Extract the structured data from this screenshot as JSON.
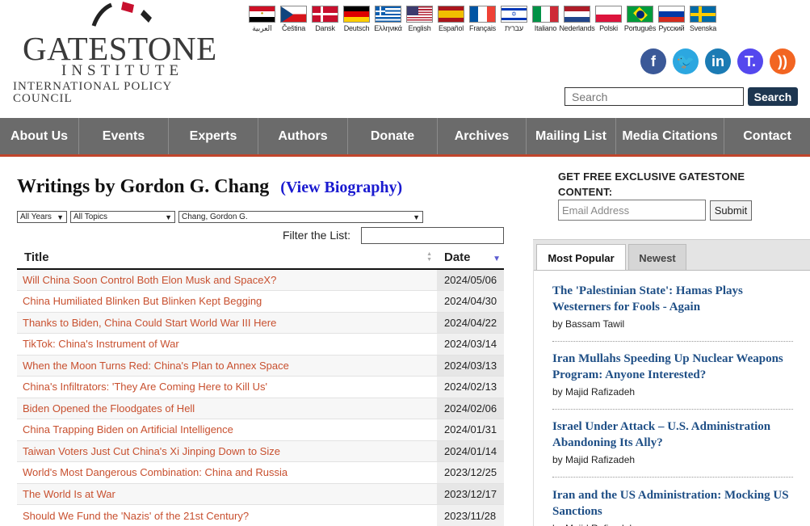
{
  "header": {
    "logo_main": "GATESTONE",
    "logo_sub": "INSTITUTE",
    "logo_tag": "INTERNATIONAL POLICY COUNCIL",
    "languages": [
      {
        "label": "العربية",
        "flag": "eg"
      },
      {
        "label": "Čeština",
        "flag": "cz"
      },
      {
        "label": "Dansk",
        "flag": "dk"
      },
      {
        "label": "Deutsch",
        "flag": "de"
      },
      {
        "label": "Ελληνικά",
        "flag": "gr"
      },
      {
        "label": "English",
        "flag": "us"
      },
      {
        "label": "Español",
        "flag": "es"
      },
      {
        "label": "Français",
        "flag": "fr"
      },
      {
        "label": "עברית",
        "flag": "il"
      },
      {
        "label": "Italiano",
        "flag": "it"
      },
      {
        "label": "Nederlands",
        "flag": "nl"
      },
      {
        "label": "Polski",
        "flag": "pl"
      },
      {
        "label": "Português",
        "flag": "br"
      },
      {
        "label": "Русский",
        "flag": "ru"
      },
      {
        "label": "Svenska",
        "flag": "se"
      }
    ],
    "social": [
      {
        "name": "facebook-icon",
        "glyph": "f",
        "color": "#3b5998"
      },
      {
        "name": "twitter-icon",
        "glyph": "🐦",
        "color": "#2ca7e0"
      },
      {
        "name": "linkedin-icon",
        "glyph": "in",
        "color": "#1b7bb4"
      },
      {
        "name": "truth-social-icon",
        "glyph": "T.",
        "color": "#5448ee"
      },
      {
        "name": "rss-icon",
        "glyph": "))",
        "color": "#f26522"
      }
    ],
    "search_placeholder": "Search",
    "search_button": "Search"
  },
  "nav": [
    {
      "label": "About Us",
      "w": 98
    },
    {
      "label": "Events",
      "w": 111
    },
    {
      "label": "Experts",
      "w": 111
    },
    {
      "label": "Authors",
      "w": 111
    },
    {
      "label": "Donate",
      "w": 111
    },
    {
      "label": "Archives",
      "w": 110
    },
    {
      "label": "Mailing List",
      "w": 111
    },
    {
      "label": "Media Citations",
      "w": 134
    },
    {
      "label": "Contact",
      "w": 106
    }
  ],
  "main": {
    "title": "Writings by Gordon G. Chang",
    "bio_link": "(View Biography)",
    "filters": {
      "years": "All Years",
      "topics": "All Topics",
      "author": "Chang, Gordon G."
    },
    "filter_label": "Filter the List:",
    "columns": {
      "title": "Title",
      "date": "Date"
    },
    "rows": [
      {
        "title": "Will China Soon Control Both Elon Musk and SpaceX?",
        "date": "2024/05/06"
      },
      {
        "title": "China Humiliated Blinken But Blinken Kept Begging",
        "date": "2024/04/30"
      },
      {
        "title": "Thanks to Biden, China Could Start World War III Here",
        "date": "2024/04/22"
      },
      {
        "title": "TikTok: China's Instrument of War",
        "date": "2024/03/14"
      },
      {
        "title": "When the Moon Turns Red: China's Plan to Annex Space",
        "date": "2024/03/13"
      },
      {
        "title": "China's Infiltrators: 'They Are Coming Here to Kill Us'",
        "date": "2024/02/13"
      },
      {
        "title": "Biden Opened the Floodgates of Hell",
        "date": "2024/02/06"
      },
      {
        "title": "China Trapping Biden on Artificial Intelligence",
        "date": "2024/01/31"
      },
      {
        "title": "Taiwan Voters Just Cut China's Xi Jinping Down to Size",
        "date": "2024/01/14"
      },
      {
        "title": "World's Most Dangerous Combination: China and Russia",
        "date": "2023/12/25"
      },
      {
        "title": "The World Is at War",
        "date": "2023/12/17"
      },
      {
        "title": "Should We Fund the 'Nazis' of the 21st Century?",
        "date": "2023/11/28"
      }
    ]
  },
  "sidebar": {
    "promo": "GET FREE EXCLUSIVE GATESTONE CONTENT:",
    "email_placeholder": "Email Address",
    "submit": "Submit",
    "tabs": {
      "popular": "Most Popular",
      "newest": "Newest"
    },
    "articles": [
      {
        "title": "The 'Palestinian State': Hamas Plays Westerners for Fools - Again",
        "author": "by Bassam Tawil"
      },
      {
        "title": "Iran Mullahs Speeding Up Nuclear Weapons Program: Anyone Interested?",
        "author": "by Majid Rafizadeh"
      },
      {
        "title": "Israel Under Attack – U.S. Administration Abandoning Its Ally?",
        "author": "by Majid Rafizadeh"
      },
      {
        "title": "Iran and the US Administration: Mocking US Sanctions",
        "author": "by Majid Rafizadeh"
      }
    ]
  }
}
